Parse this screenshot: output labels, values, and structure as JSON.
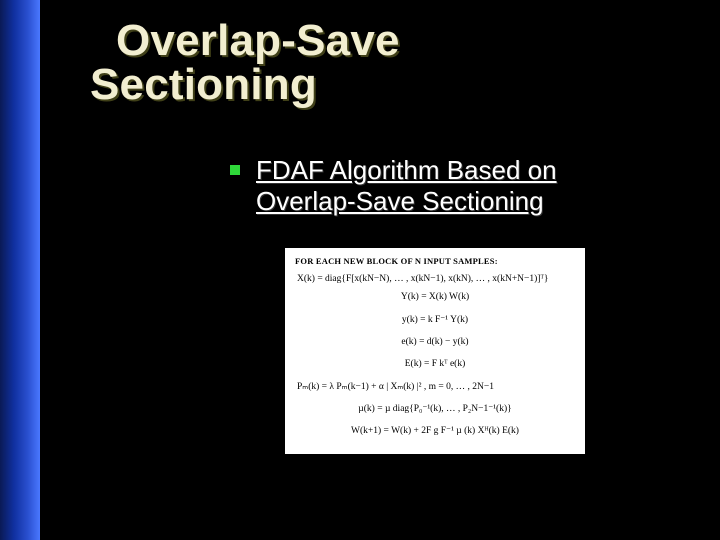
{
  "slide": {
    "title_line1": "Overlap-Save",
    "title_line2": "Sectioning",
    "bullet_text": "FDAF Algorithm Based on Overlap-Save Sectioning"
  },
  "figure": {
    "header": "FOR EACH NEW BLOCK OF N INPUT SAMPLES:",
    "eq1a": "X(k)  =  diag{F[x(kN−N), … , x(kN−1), x(kN), … , x(kN+N−1)]ᵀ}",
    "eq1b": "Y(k)  =  X(k) W(k)",
    "eq2": "y(k)  =  k F⁻¹ Y(k)",
    "eq3": "e(k)  =  d(k) − y(k)",
    "eq4": "E(k)  =  F kᵀ e(k)",
    "eq5": "Pₘ(k)  =  λ Pₘ(k−1) + α | Xₘ(k) |² ,   m = 0, … , 2N−1",
    "eq6": "µ(k)  =  µ diag{P₀⁻¹(k), … , P₂N−1⁻¹(k)}",
    "eq7": "W(k+1)  =  W(k) + 2F g F⁻¹ µ (k) Xᴴ(k) E(k)"
  }
}
